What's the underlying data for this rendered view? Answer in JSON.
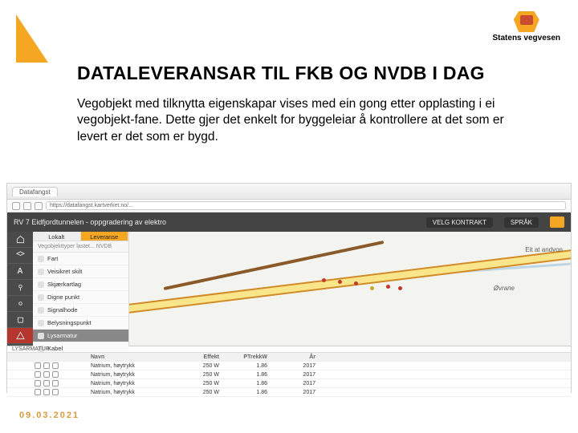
{
  "brand": {
    "name": "Statens vegvesen"
  },
  "slide": {
    "title": "DATALEVERANSAR TIL FKB OG NVDB I DAG",
    "body": "Vegobjekt med tilknytta eigenskapar vises med ein gong etter opplasting i ei vegobjekt-fane. Dette gjer det enkelt for byggeleiar å kontrollere at det som er levert er det som er bygd.",
    "date": "09.03.2021"
  },
  "browser": {
    "tab": "Datafangst",
    "url": "https://datafangst.kartverket.no/..."
  },
  "app": {
    "header_title": "RV 7 Eidfjordtunnelen - oppgradering av elektro",
    "menu1": "VELG KONTRAKT",
    "menu2": "SPRÅK"
  },
  "sidebar": {
    "icons": [
      "home",
      "layers",
      "eye",
      "A",
      "pin",
      "gear",
      "trash",
      "warn",
      "dl",
      "cross"
    ]
  },
  "left_panel": {
    "tab1": "Lokalt",
    "tab2": "Leveranse",
    "sub": "Vegobjekttyper lastet... NVDB",
    "items": [
      {
        "label": "Fart"
      },
      {
        "label": "Veisikret skilt"
      },
      {
        "label": "Skjærkartlag"
      },
      {
        "label": "Digne punkt"
      },
      {
        "label": "Signalhode"
      },
      {
        "label": "Belysningspunkt"
      },
      {
        "label": "Lysarmatur",
        "active": true
      },
      {
        "label": "Kabel"
      }
    ]
  },
  "map": {
    "label_ovrane": "Øvrane",
    "label_eit": "Eit at andvon"
  },
  "table": {
    "title": "LYSARMATUR",
    "headers": {
      "c3": "Navn",
      "c4": "Effekt",
      "c5": "PTrekkW",
      "c6": "År"
    },
    "rows": [
      {
        "name": "Natrium, høytrykk",
        "v1": "250 W",
        "v2": "1.86",
        "v3": "2017"
      },
      {
        "name": "Natrium, høytrykk",
        "v1": "250 W",
        "v2": "1.86",
        "v3": "2017"
      },
      {
        "name": "Natrium, høytrykk",
        "v1": "250 W",
        "v2": "1.86",
        "v3": "2017"
      },
      {
        "name": "Natrium, høytrykk",
        "v1": "250 W",
        "v2": "1.86",
        "v3": "2017"
      }
    ]
  }
}
